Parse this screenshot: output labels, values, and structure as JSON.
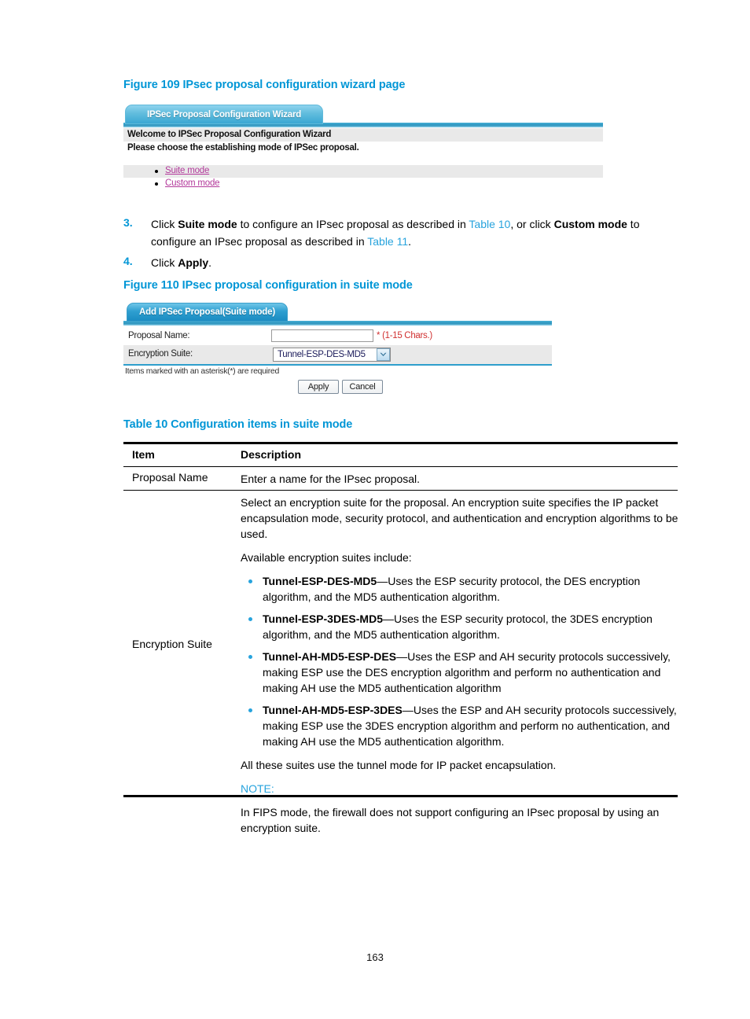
{
  "page": {
    "number": "163"
  },
  "figure109": {
    "caption": "Figure 109 IPsec proposal configuration wizard page",
    "tab_label": "IPSec Proposal Configuration Wizard",
    "welcome_line": "Welcome to IPSec Proposal Configuration Wizard",
    "instruction_line": "Please choose the establishing mode of IPSec proposal.",
    "links": [
      {
        "label": "Suite mode"
      },
      {
        "label": "Custom mode"
      }
    ]
  },
  "steps": [
    {
      "number": "3.",
      "html": "Click <b>Suite mode</b> to configure an IPsec proposal as described in <span class=\"xref\">Table 10</span>, or click <b>Custom mode</b> to configure an IPsec proposal as described in <span class=\"xref\">Table 11</span>."
    },
    {
      "number": "4.",
      "html": "Click <b>Apply</b>."
    }
  ],
  "figure110": {
    "caption": "Figure 110 IPsec proposal configuration in suite mode",
    "tab_label": "Add IPSec Proposal(Suite mode)",
    "fields": {
      "proposal_name_label": "Proposal Name:",
      "proposal_name_value": "",
      "proposal_name_hint": "* (1-15 Chars.)",
      "encryption_suite_label": "Encryption Suite:",
      "encryption_suite_value": "Tunnel-ESP-DES-MD5",
      "encryption_suite_options": [
        "Tunnel-ESP-DES-MD5",
        "Tunnel-ESP-3DES-MD5",
        "Tunnel-AH-MD5-ESP-DES",
        "Tunnel-AH-MD5-ESP-3DES"
      ]
    },
    "required_note": "Items marked with an asterisk(*) are required",
    "buttons": {
      "apply": "Apply",
      "cancel": "Cancel"
    }
  },
  "table10": {
    "caption": "Table 10 Configuration items in suite mode",
    "headers": {
      "item": "Item",
      "description": "Description"
    },
    "rows": [
      {
        "item": "Proposal Name",
        "description_html": "<p>Enter a name for the IPsec proposal.</p>"
      },
      {
        "item": "Encryption Suite",
        "description_html": "<p>Select an encryption suite for the proposal. An encryption suite specifies the IP packet encapsulation mode, security protocol, and authentication and encryption algorithms to be used.</p><p>Available encryption suites include:</p><ul class=\"suites\"><li><b>Tunnel-ESP-DES-MD5</b>&#8212;Uses the ESP security protocol, the DES encryption algorithm, and the MD5 authentication algorithm.</li><li><b>Tunnel-ESP-3DES-MD5</b>&#8212;Uses the ESP security protocol, the 3DES encryption algorithm, and the MD5 authentication algorithm.</li><li><b>Tunnel-AH-MD5-ESP-DES</b>&#8212;Uses the ESP and AH security protocols successively, making ESP use the DES encryption algorithm and perform no authentication and making AH use the MD5 authentication algorithm</li><li><b>Tunnel-AH-MD5-ESP-3DES</b>&#8212;Uses the ESP and AH security protocols successively, making ESP use the 3DES encryption algorithm and perform no authentication, and making AH use the MD5 authentication algorithm.</li></ul><p>All these suites use the tunnel mode for IP packet encapsulation.</p><p class=\"note-label\">NOTE:</p><p>In FIPS mode, the firewall does not support configuring an IPsec proposal by using an encryption suite.</p>"
      }
    ]
  },
  "colors": {
    "accent_blue": "#0096d6",
    "xref_blue": "#27a3dd",
    "link_magenta": "#b3399b",
    "band_gray": "#e9e9e9",
    "required_red": "#d03030"
  }
}
